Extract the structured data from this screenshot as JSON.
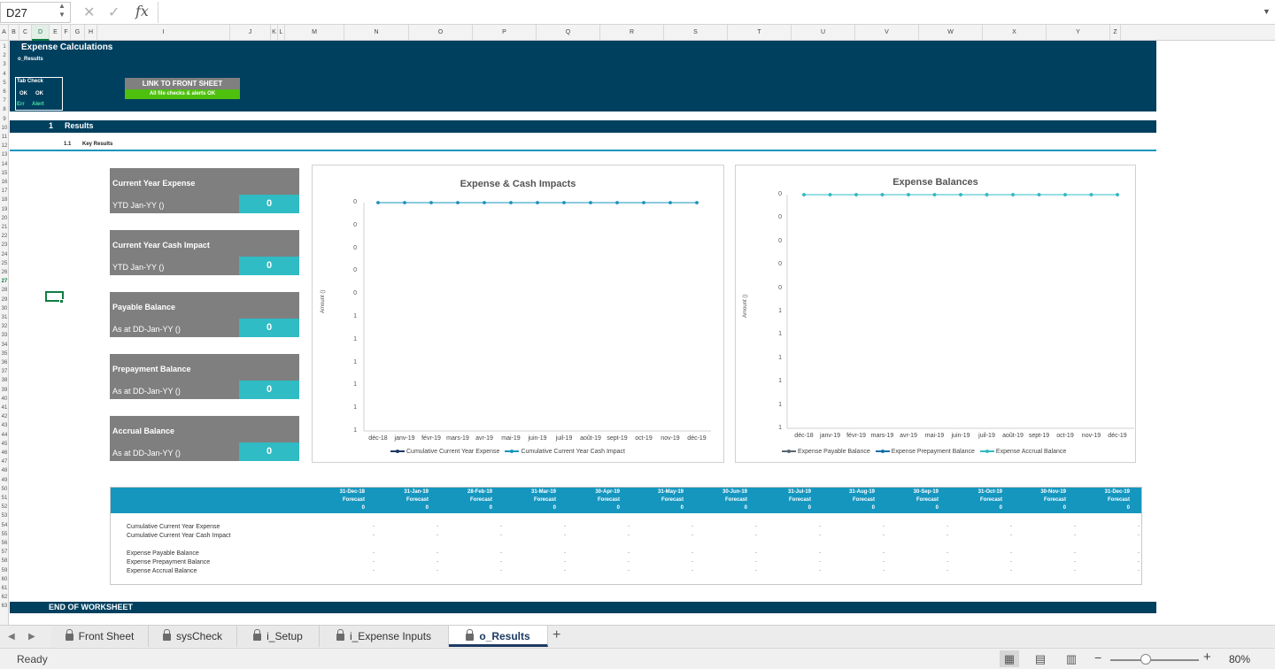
{
  "formula_bar": {
    "name_box": "D27",
    "fx": "fx",
    "formula": ""
  },
  "columns": [
    "A",
    "B",
    "C",
    "D",
    "E",
    "F",
    "G",
    "H",
    "I",
    "J",
    "K",
    "L",
    "M",
    "N",
    "O",
    "P",
    "Q",
    "R",
    "S",
    "T",
    "U",
    "V",
    "W",
    "X",
    "Y",
    "Z"
  ],
  "selected_column": "D",
  "selected_row": "27",
  "header": {
    "title": "Expense Calculations",
    "sheet_code": "o_Results",
    "tab_check_label": "Tab Check",
    "ok1": "OK",
    "ok2": "OK",
    "err": "Err",
    "alert": "Alert",
    "link_button": "LINK TO FRONT SHEET",
    "checks_status": "All file checks & alerts OK"
  },
  "section": {
    "number": "1",
    "title": "Results",
    "sub_number": "1.1",
    "sub_title": "Key Results"
  },
  "kpis": [
    {
      "title": "Current Year Expense",
      "sub": "YTD Jan-YY ()",
      "value": "0"
    },
    {
      "title": "Current Year Cash Impact",
      "sub": "YTD Jan-YY ()",
      "value": "0"
    },
    {
      "title": "Payable Balance",
      "sub": "As at DD-Jan-YY ()",
      "value": "0"
    },
    {
      "title": "Prepayment Balance",
      "sub": "As at DD-Jan-YY ()",
      "value": "0"
    },
    {
      "title": "Accrual Balance",
      "sub": "As at DD-Jan-YY ()",
      "value": "0"
    }
  ],
  "chart_data": [
    {
      "type": "line",
      "title": "Expense & Cash Impacts",
      "ylabel": "Amount ()",
      "x": [
        "déc-18",
        "janv-19",
        "févr-19",
        "mars-19",
        "avr-19",
        "mai-19",
        "juin-19",
        "juil-19",
        "août-19",
        "sept-19",
        "oct-19",
        "nov-19",
        "déc-19"
      ],
      "y_tick_labels": [
        "0",
        "0",
        "0",
        "0",
        "0",
        "1",
        "1",
        "1",
        "1",
        "1",
        "1"
      ],
      "series": [
        {
          "name": "Cumulative Current Year Expense",
          "color": "#1f3864",
          "values": [
            0,
            0,
            0,
            0,
            0,
            0,
            0,
            0,
            0,
            0,
            0,
            0,
            0
          ]
        },
        {
          "name": "Cumulative Current Year Cash Impact",
          "color": "#1496bf",
          "values": [
            0,
            0,
            0,
            0,
            0,
            0,
            0,
            0,
            0,
            0,
            0,
            0,
            0
          ]
        }
      ]
    },
    {
      "type": "line",
      "title": "Expense Balances",
      "ylabel": "Amount ()",
      "x": [
        "déc-18",
        "janv-19",
        "févr-19",
        "mars-19",
        "avr-19",
        "mai-19",
        "juin-19",
        "juil-19",
        "août-19",
        "sept-19",
        "oct-19",
        "nov-19",
        "déc-19"
      ],
      "y_tick_labels": [
        "0",
        "0",
        "0",
        "0",
        "0",
        "1",
        "1",
        "1",
        "1",
        "1",
        "1"
      ],
      "series": [
        {
          "name": "Expense Payable Balance",
          "color": "#5a6772",
          "values": [
            0,
            0,
            0,
            0,
            0,
            0,
            0,
            0,
            0,
            0,
            0,
            0,
            0
          ]
        },
        {
          "name": "Expense Prepayment Balance",
          "color": "#1470a8",
          "values": [
            0,
            0,
            0,
            0,
            0,
            0,
            0,
            0,
            0,
            0,
            0,
            0,
            0
          ]
        },
        {
          "name": "Expense Accrual Balance",
          "color": "#2fbcc4",
          "values": [
            0,
            0,
            0,
            0,
            0,
            0,
            0,
            0,
            0,
            0,
            0,
            0,
            0
          ]
        }
      ]
    }
  ],
  "table": {
    "dates": [
      "31-Dec-18",
      "31-Jan-19",
      "28-Feb-19",
      "31-Mar-19",
      "30-Apr-19",
      "31-May-19",
      "30-Jun-19",
      "31-Jul-19",
      "31-Aug-19",
      "30-Sep-19",
      "31-Oct-19",
      "30-Nov-19",
      "31-Dec-19"
    ],
    "kind": "Forecast",
    "header_zero": "0",
    "rows": [
      "Cumulative Current Year Expense",
      "Cumulative Current Year Cash Impact",
      "Expense Payable Balance",
      "Expense Prepayment Balance",
      "Expense Accrual Balance"
    ],
    "cell": "-"
  },
  "end_label": "END OF WORKSHEET",
  "tabs": [
    "Front Sheet",
    "sysCheck",
    "i_Setup",
    "i_Expense Inputs",
    "o_Results"
  ],
  "active_tab": "o_Results",
  "status": {
    "text": "Ready",
    "zoom": "80%"
  },
  "colors": {
    "band": "#00405f",
    "accent": "#2fbcc4",
    "kpi_bg": "#7f7f7f",
    "table_head": "#1496bf",
    "excel_green": "#107c41"
  }
}
